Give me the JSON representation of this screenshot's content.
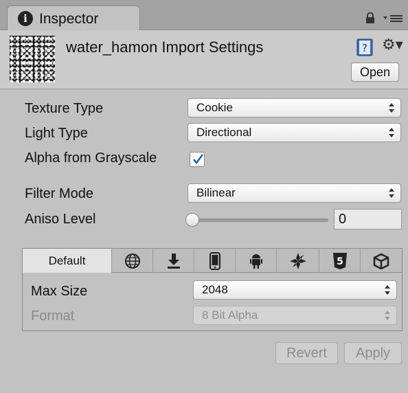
{
  "tab": {
    "title": "Inspector",
    "icon": "info-icon",
    "lock_icon": "lock-icon",
    "menu_icon": "menu-icon"
  },
  "header": {
    "title": "water_hamon Import Settings",
    "open_label": "Open",
    "help_icon": "help-book-icon",
    "settings_icon": "gear-icon"
  },
  "properties": {
    "texture_type": {
      "label": "Texture Type",
      "value": "Cookie"
    },
    "light_type": {
      "label": "Light Type",
      "value": "Directional"
    },
    "alpha_from_grayscale": {
      "label": "Alpha from Grayscale",
      "checked": true
    },
    "filter_mode": {
      "label": "Filter Mode",
      "value": "Bilinear"
    },
    "aniso_level": {
      "label": "Aniso Level",
      "value": "0",
      "slider_fraction": 0
    }
  },
  "platforms": {
    "tabs": [
      "Default",
      "globe-icon",
      "download-icon",
      "phone-icon",
      "android-icon",
      "flash-icon",
      "html5-icon",
      "box-icon"
    ],
    "max_size": {
      "label": "Max Size",
      "value": "2048"
    },
    "format": {
      "label": "Format",
      "value": "8 Bit Alpha",
      "disabled": true
    }
  },
  "actions": {
    "revert": "Revert",
    "apply": "Apply"
  },
  "colors": {
    "panel": "#c2c2c2",
    "tabbar": "#a3a3a3",
    "checkmark": "#2a5ea8"
  }
}
